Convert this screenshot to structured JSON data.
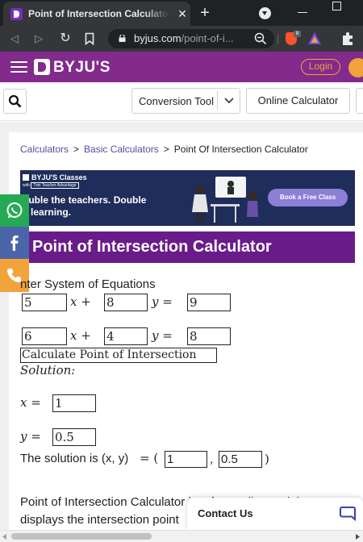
{
  "browser": {
    "tab_title": "Point of Intersection Calculator - B",
    "tab_close": "✕",
    "new_tab": "+",
    "url_host": "byjus.com",
    "url_path": "/point-of-i...",
    "brave_badge": "8",
    "nav": {
      "back": "◁",
      "forward": "▷",
      "reload": "↻"
    }
  },
  "site": {
    "brand": "BYJU'S",
    "login": "Login",
    "accent_color": "#822b8c"
  },
  "search_row": {
    "conversion_tool": "Conversion Tool",
    "online_calculator": "Online Calculator"
  },
  "breadcrumb": [
    "Calculators",
    "Basic Calculators",
    "Point Of Intersection Calculator"
  ],
  "banner": {
    "brand": "BYJU'S Classes",
    "tag_with": "with",
    "tag_label": "Two Teacher Advantage",
    "line1": "ouble the teachers. Double",
    "line2": "e learning.",
    "cta": "Book a Free Class"
  },
  "title": "Point of Intersection Calculator",
  "calculator": {
    "label": "nter System of Equations",
    "eq1": {
      "a": "5",
      "b": "8",
      "c": "9"
    },
    "eq2": {
      "a": "6",
      "b": "4",
      "c": "8"
    },
    "button": "Calculate Point of Intersection",
    "solution_label": "Solution:",
    "x_label": "x =",
    "x_value": "1",
    "y_label": "y =",
    "y_value": "0.5",
    "solution_prefix": "The solution is (x, y)",
    "solution_eq": "= (",
    "solution_x": "1",
    "solution_y": "0.5",
    "comma": ",",
    "close_paren": ")",
    "x_var": "x",
    "y_var": "y",
    "plus": "+",
    "equals": "="
  },
  "paragraph": "Point of Intersection Calculator is a free online tool that displays the intersection point",
  "contact": "Contact Us"
}
